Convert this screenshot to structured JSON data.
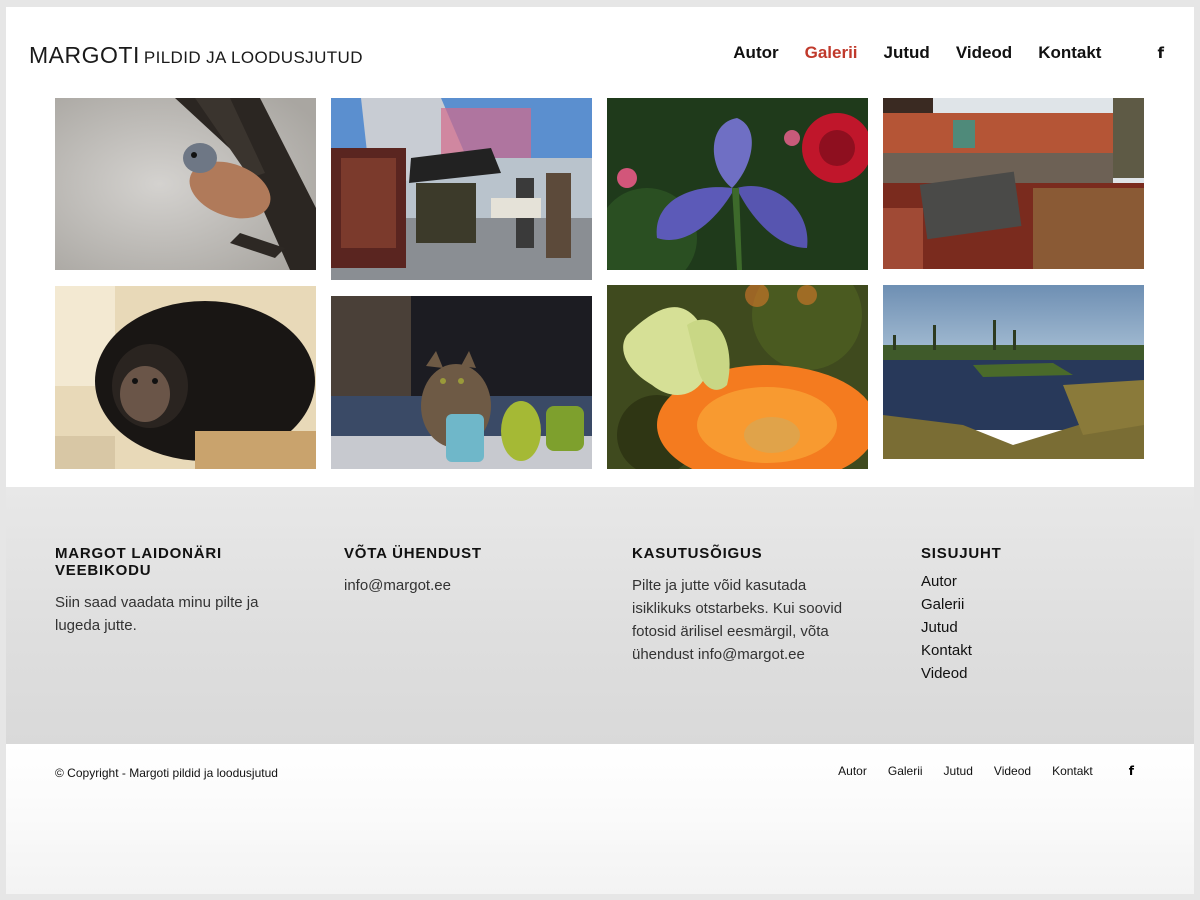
{
  "header": {
    "logo_main": "MARGOTI",
    "logo_sub": "PILDID JA LOODUSJUTUD",
    "nav": [
      {
        "label": "Autor",
        "active": false
      },
      {
        "label": "Galerii",
        "active": true
      },
      {
        "label": "Jutud",
        "active": false
      },
      {
        "label": "Videod",
        "active": false
      },
      {
        "label": "Kontakt",
        "active": false
      }
    ],
    "social_icon": "f"
  },
  "gallery": {
    "photos": [
      {
        "subject": "bird-on-branch-photo"
      },
      {
        "subject": "street-market-photo"
      },
      {
        "subject": "purple-iris-photo"
      },
      {
        "subject": "old-house-rugs-photo"
      },
      {
        "subject": "chimpanzee-photo"
      },
      {
        "subject": "cat-with-vases-photo"
      },
      {
        "subject": "butterfly-on-flower-photo"
      },
      {
        "subject": "bog-lake-photo"
      }
    ]
  },
  "footer": {
    "col1": {
      "title": "MARGOT LAIDONÄRI VEEBIKODU",
      "text": "Siin saad vaadata minu pilte ja lugeda jutte."
    },
    "col2": {
      "title": "VÕTA ÜHENDUST",
      "text": "info@margot.ee"
    },
    "col3": {
      "title": "KASUTUSÕIGUS",
      "text": "Pilte ja jutte võid kasutada isiklikuks otstarbeks. Kui soovid fotosid ärilisel eesmärgil, võta ühendust info@margot.ee"
    },
    "col4": {
      "title": "SISUJUHT",
      "links": [
        "Autor",
        "Galerii",
        "Jutud",
        "Kontakt",
        "Videod"
      ]
    }
  },
  "bottom": {
    "copyright": "© Copyright - Margoti pildid ja loodusjutud",
    "nav": [
      "Autor",
      "Galerii",
      "Jutud",
      "Videod",
      "Kontakt"
    ],
    "social_icon": "f"
  },
  "colors": {
    "accent": "#c0392b",
    "text": "#111111",
    "footer_bg": "#dedede"
  }
}
